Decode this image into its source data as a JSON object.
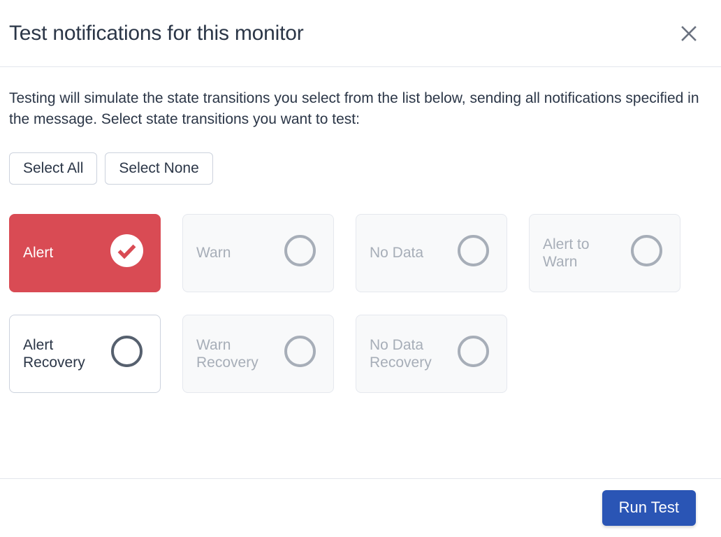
{
  "dialog": {
    "title": "Test notifications for this monitor",
    "close_icon": "close-icon",
    "description": "Testing will simulate the state transitions you select from the list below, sending all notifications specified in the message. Select state transitions you want to test:"
  },
  "selection_controls": {
    "select_all_label": "Select All",
    "select_none_label": "Select None"
  },
  "state_cards": [
    {
      "label": "Alert",
      "state": "selected",
      "indicator": "check-circle-filled-icon"
    },
    {
      "label": "Warn",
      "state": "muted",
      "indicator": "circle-outline-icon"
    },
    {
      "label": "No Data",
      "state": "muted",
      "indicator": "circle-outline-icon"
    },
    {
      "label": "Alert to Warn",
      "state": "muted",
      "indicator": "circle-outline-icon"
    },
    {
      "label": "Alert Recovery",
      "state": "enabled",
      "indicator": "circle-outline-icon"
    },
    {
      "label": "Warn Recovery",
      "state": "muted",
      "indicator": "circle-outline-icon"
    },
    {
      "label": "No Data Recovery",
      "state": "muted",
      "indicator": "circle-outline-icon"
    }
  ],
  "footer": {
    "run_test_label": "Run Test"
  },
  "colors": {
    "selected_red": "#d94b54",
    "primary_blue": "#2a55b5",
    "muted_bg": "#f8f9fa",
    "muted_text": "#a7aeb8",
    "body_text": "#2b3647",
    "border": "#ccd2dd",
    "divider": "#e3e6ec"
  }
}
